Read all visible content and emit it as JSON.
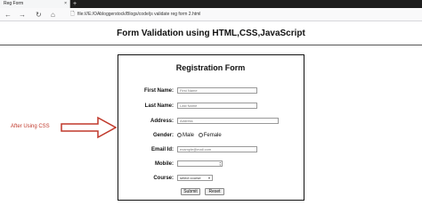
{
  "browser": {
    "tab_title": "Reg Form",
    "tab_close": "×",
    "new_tab": "+",
    "nav": {
      "back": "←",
      "forward": "→",
      "reload": "↻",
      "home": "⌂"
    },
    "url_icon": "file-icon",
    "url": "file:///E:/OAbloggerstock/Blogs/code/js validate reg form 2.html"
  },
  "page": {
    "heading": "Form Validation using HTML,CSS,JavaScript"
  },
  "form": {
    "title": "Registration Form",
    "first_name": {
      "label": "First Name:",
      "placeholder": "First Name"
    },
    "last_name": {
      "label": "Last Name:",
      "placeholder": "Last Name"
    },
    "address": {
      "label": "Address:",
      "placeholder": "Address"
    },
    "gender": {
      "label": "Gender:",
      "options": [
        "Male",
        "Female"
      ]
    },
    "email": {
      "label": "Email Id:",
      "placeholder": "example@mail.com"
    },
    "mobile": {
      "label": "Mobile:",
      "value": ""
    },
    "course": {
      "label": "Course:",
      "selected": "select course"
    },
    "submit_label": "Submit",
    "reset_label": "Reset"
  },
  "annotation": {
    "text": "After Using CSS",
    "color": "#c0392b"
  }
}
